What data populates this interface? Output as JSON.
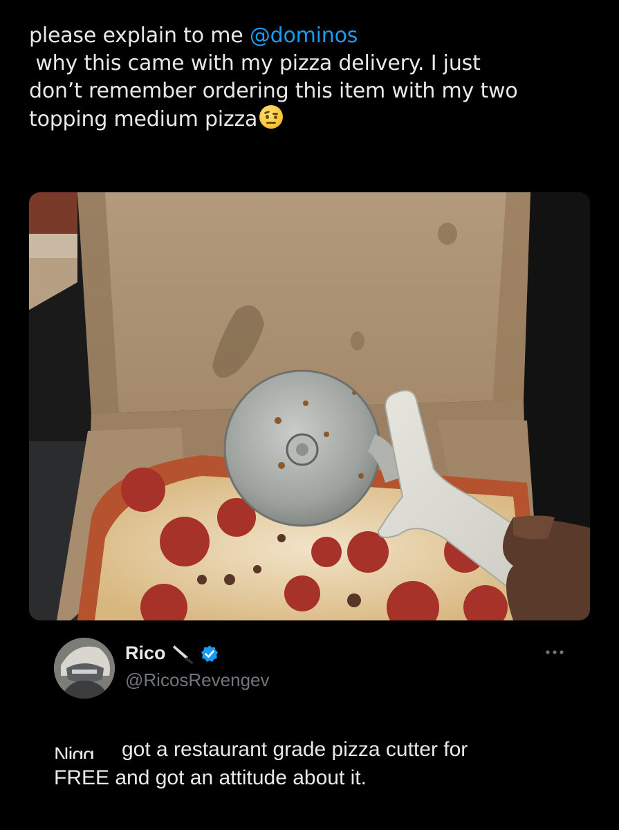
{
  "tweet": {
    "line1_prefix": "please explain to me ",
    "mention": "@dominos",
    "line2": " why this came with my pizza delivery. I just",
    "line3": "don’t remember ordering this item with my two",
    "line4": "topping medium pizza",
    "emoji_icon": "face-with-raised-eyebrow-icon"
  },
  "photo": {
    "subject_icon": "pizza-cutter-in-pizza-box-photo"
  },
  "reply": {
    "display_name": "Rico",
    "name_emoji_icon": "kitchen-knife-icon",
    "verified_icon": "verified-badge-icon",
    "handle": "@RicosRevengev",
    "more_icon": "more-options-icon",
    "text_line1_censored": "Nigg",
    "text_line1": "got a restaurant grade pizza cutter for",
    "text_line2": "FREE and got an attitude about it."
  },
  "colors": {
    "background": "#000000",
    "text": "#e7e9ea",
    "mention": "#1d9bf0",
    "secondary": "#71767b",
    "verified": "#1d9bf0"
  }
}
